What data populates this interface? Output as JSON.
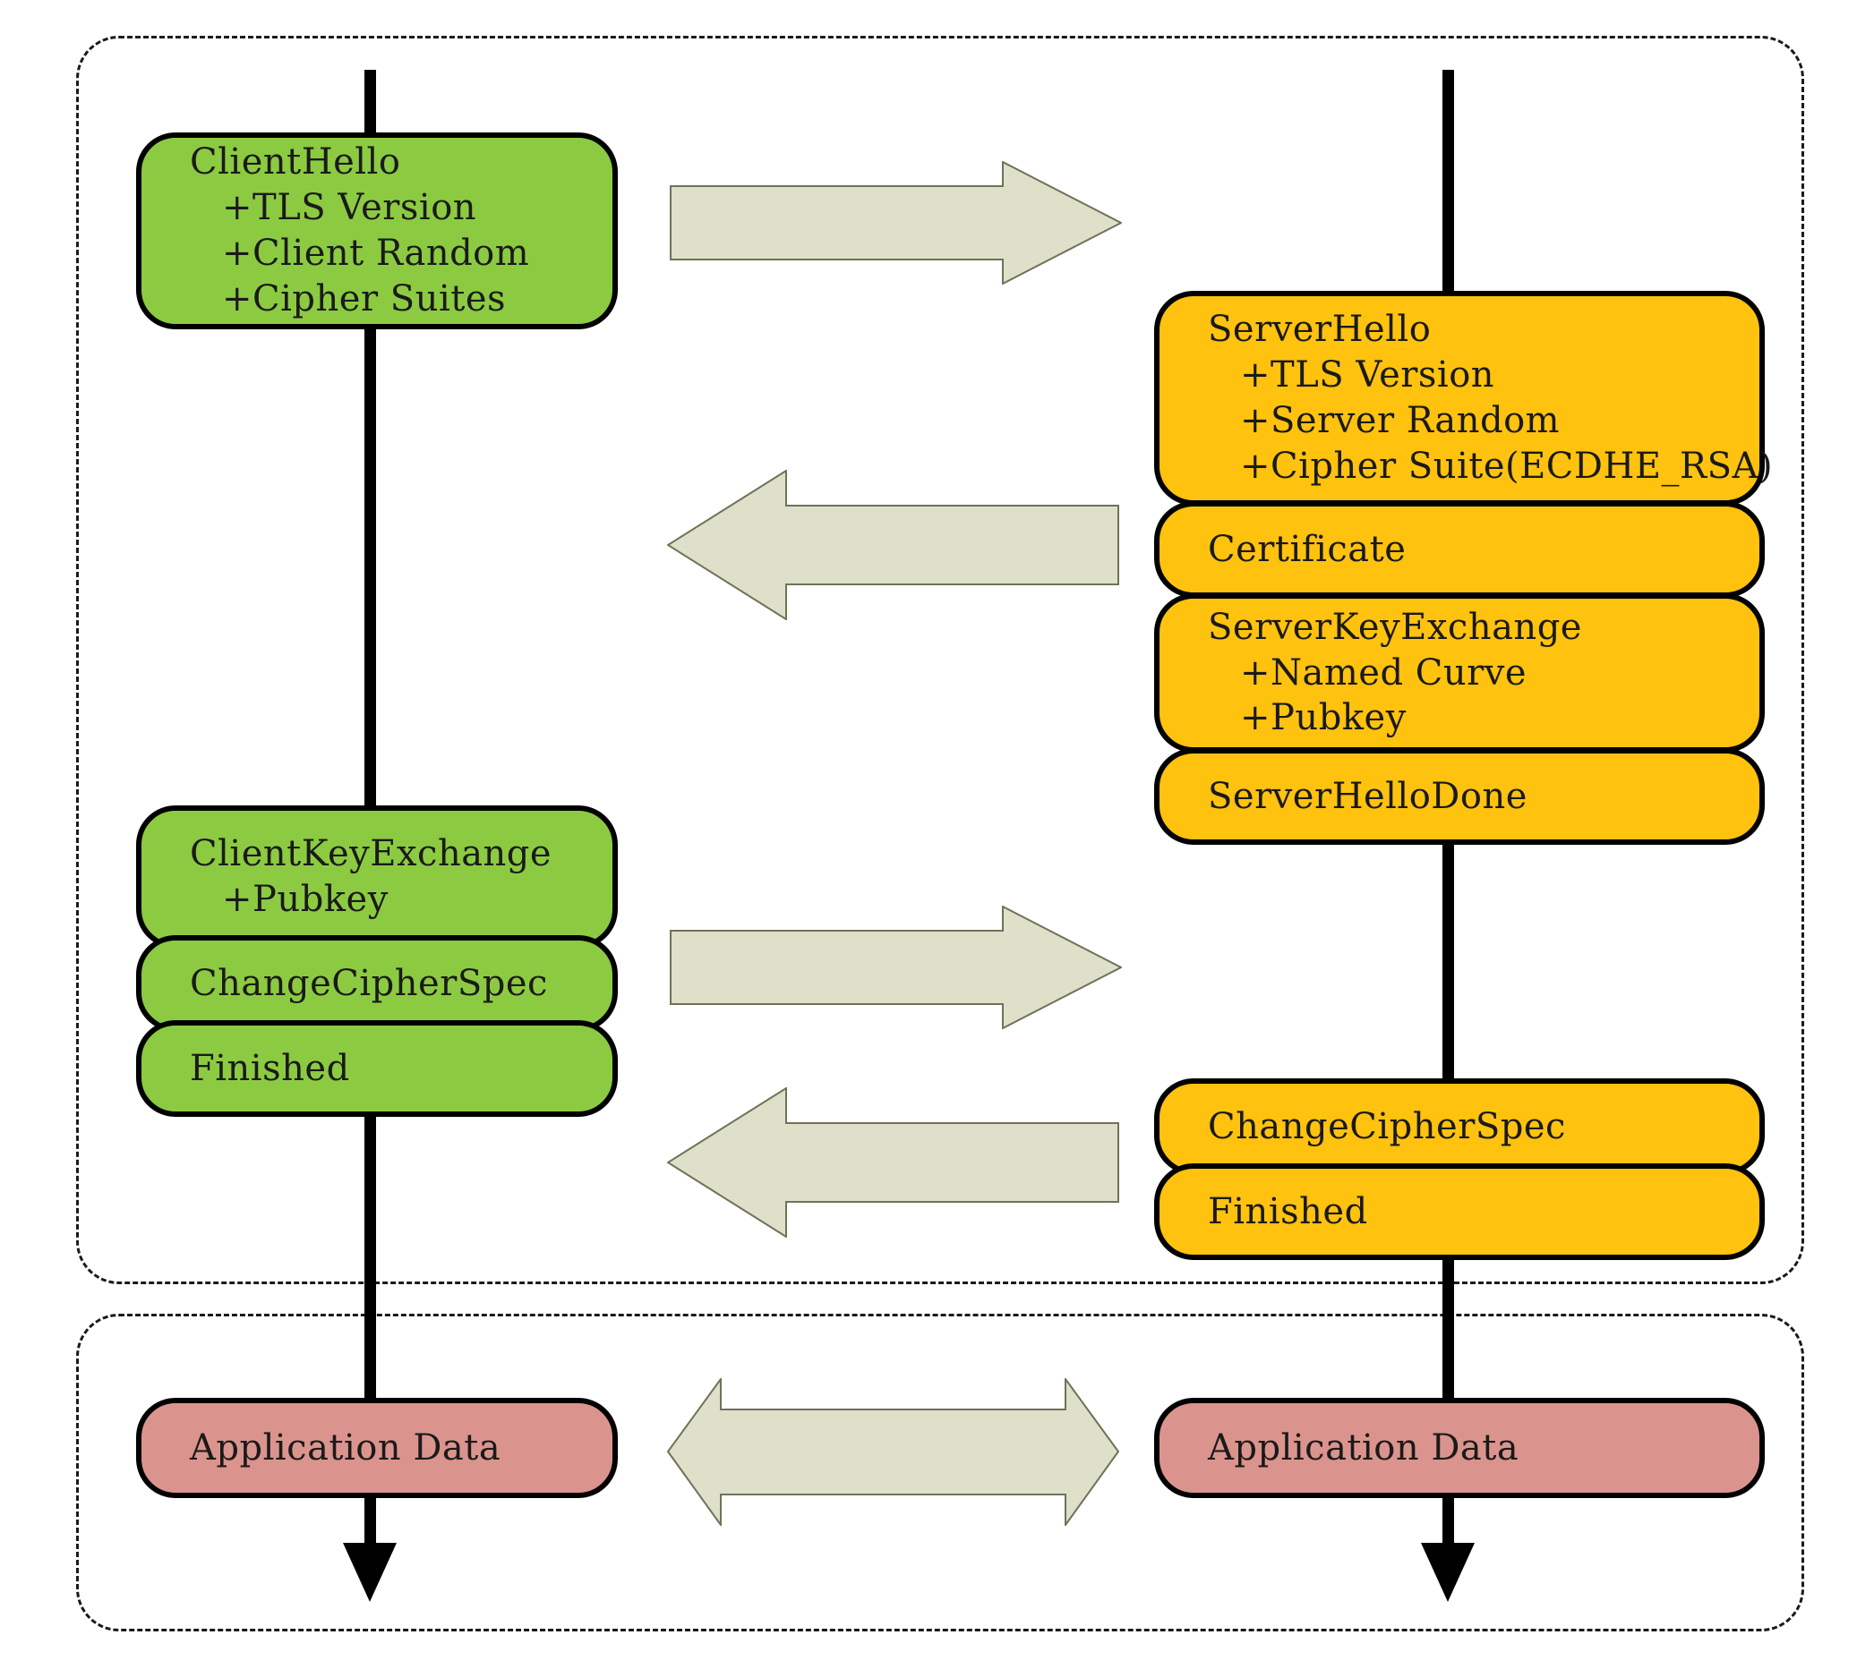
{
  "diagram": {
    "title": "TLS 1.2 Handshake (ECDHE_RSA)",
    "colors": {
      "client_box": "#8CCB41",
      "server_box": "#FFC20E",
      "appdata_box": "#DB948D",
      "arrow_fill": "#DEE0CA",
      "arrow_stroke": "#6F7257",
      "timeline": "#000000",
      "region_border": "#1a1a1a"
    }
  },
  "regions": {
    "handshake": {
      "name": "handshake-phase"
    },
    "application": {
      "name": "application-data-phase"
    }
  },
  "client_messages": [
    {
      "id": "clienthello",
      "lines": [
        {
          "text": "ClientHello",
          "sub": false
        },
        {
          "text": "+TLS Version",
          "sub": true
        },
        {
          "text": "+Client Random",
          "sub": true
        },
        {
          "text": "+Cipher Suites",
          "sub": true
        }
      ]
    },
    {
      "id": "clientkeyexchange",
      "lines": [
        {
          "text": "ClientKeyExchange",
          "sub": false
        },
        {
          "text": "+Pubkey",
          "sub": true
        }
      ]
    },
    {
      "id": "client-changecipherspec",
      "lines": [
        {
          "text": "ChangeCipherSpec",
          "sub": false
        }
      ]
    },
    {
      "id": "client-finished",
      "lines": [
        {
          "text": "Finished",
          "sub": false
        }
      ]
    }
  ],
  "server_messages": [
    {
      "id": "serverhello",
      "lines": [
        {
          "text": "ServerHello",
          "sub": false
        },
        {
          "text": "+TLS Version",
          "sub": true
        },
        {
          "text": "+Server Random",
          "sub": true
        },
        {
          "text": "+Cipher Suite(ECDHE_RSA)",
          "sub": true
        }
      ]
    },
    {
      "id": "certificate",
      "lines": [
        {
          "text": "Certificate",
          "sub": false
        }
      ]
    },
    {
      "id": "serverkeyexchange",
      "lines": [
        {
          "text": "ServerKeyExchange",
          "sub": false
        },
        {
          "text": "+Named Curve",
          "sub": true
        },
        {
          "text": "+Pubkey",
          "sub": true
        }
      ]
    },
    {
      "id": "serverhellodone",
      "lines": [
        {
          "text": "ServerHelloDone",
          "sub": false
        }
      ]
    },
    {
      "id": "server-changecipherspec",
      "lines": [
        {
          "text": "ChangeCipherSpec",
          "sub": false
        }
      ]
    },
    {
      "id": "server-finished",
      "lines": [
        {
          "text": "Finished",
          "sub": false
        }
      ]
    }
  ],
  "application_data": {
    "client_label": "Application Data",
    "server_label": "Application Data"
  },
  "arrows": [
    {
      "id": "arrow-1",
      "direction": "right",
      "name": "clienthello-arrow"
    },
    {
      "id": "arrow-2",
      "direction": "left",
      "name": "serverhello-arrow"
    },
    {
      "id": "arrow-3",
      "direction": "right",
      "name": "clientkeyexchange-arrow"
    },
    {
      "id": "arrow-4",
      "direction": "left",
      "name": "server-finished-arrow"
    },
    {
      "id": "arrow-5",
      "direction": "both",
      "name": "application-data-arrow"
    }
  ],
  "text": {
    "clienthello_l0": "ClientHello",
    "clienthello_l1": "+TLS Version",
    "clienthello_l2": "+Client Random",
    "clienthello_l3": "+Cipher Suites",
    "clientkeyexchange_l0": "ClientKeyExchange",
    "clientkeyexchange_l1": "+Pubkey",
    "client_ccs": "ChangeCipherSpec",
    "client_finished": "Finished",
    "serverhello_l0": "ServerHello",
    "serverhello_l1": "+TLS Version",
    "serverhello_l2": "+Server Random",
    "serverhello_l3": "+Cipher Suite(ECDHE_RSA)",
    "certificate": "Certificate",
    "serverkeyexchange_l0": "ServerKeyExchange",
    "serverkeyexchange_l1": "+Named Curve",
    "serverkeyexchange_l2": "+Pubkey",
    "serverhellodone": "ServerHelloDone",
    "server_ccs": "ChangeCipherSpec",
    "server_finished": "Finished",
    "appdata_client": "Application Data",
    "appdata_server": "Application Data"
  }
}
